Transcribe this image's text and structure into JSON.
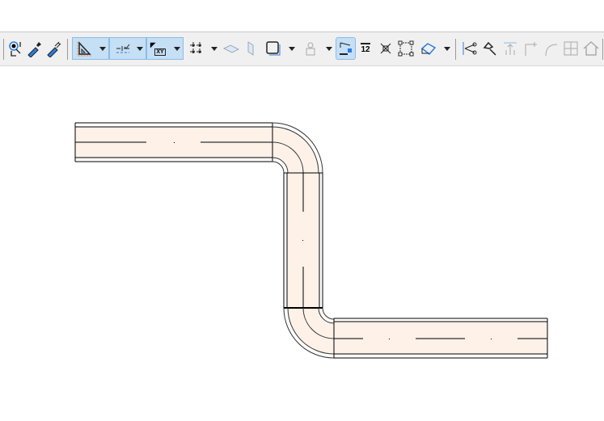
{
  "toolbar": {
    "icons": [
      "find-select",
      "eyedropper",
      "injector",
      "guide-lines",
      "snap-guides",
      "coordinate-input",
      "grid-snap",
      "plane-tilt",
      "plane-vertical",
      "suspend-groups",
      "trace-reference",
      "magic-wand-active",
      "dimension",
      "stretch",
      "drag-nodes",
      "3d-view",
      "split",
      "adjust",
      "elevate",
      "corner",
      "fillet",
      "offset",
      "roof"
    ],
    "coordinate_label": "XY",
    "dimension_label": "12"
  },
  "colors": {
    "accent": "#c5dff5",
    "duct_fill": "#fdf1e8",
    "line": "#000000"
  }
}
